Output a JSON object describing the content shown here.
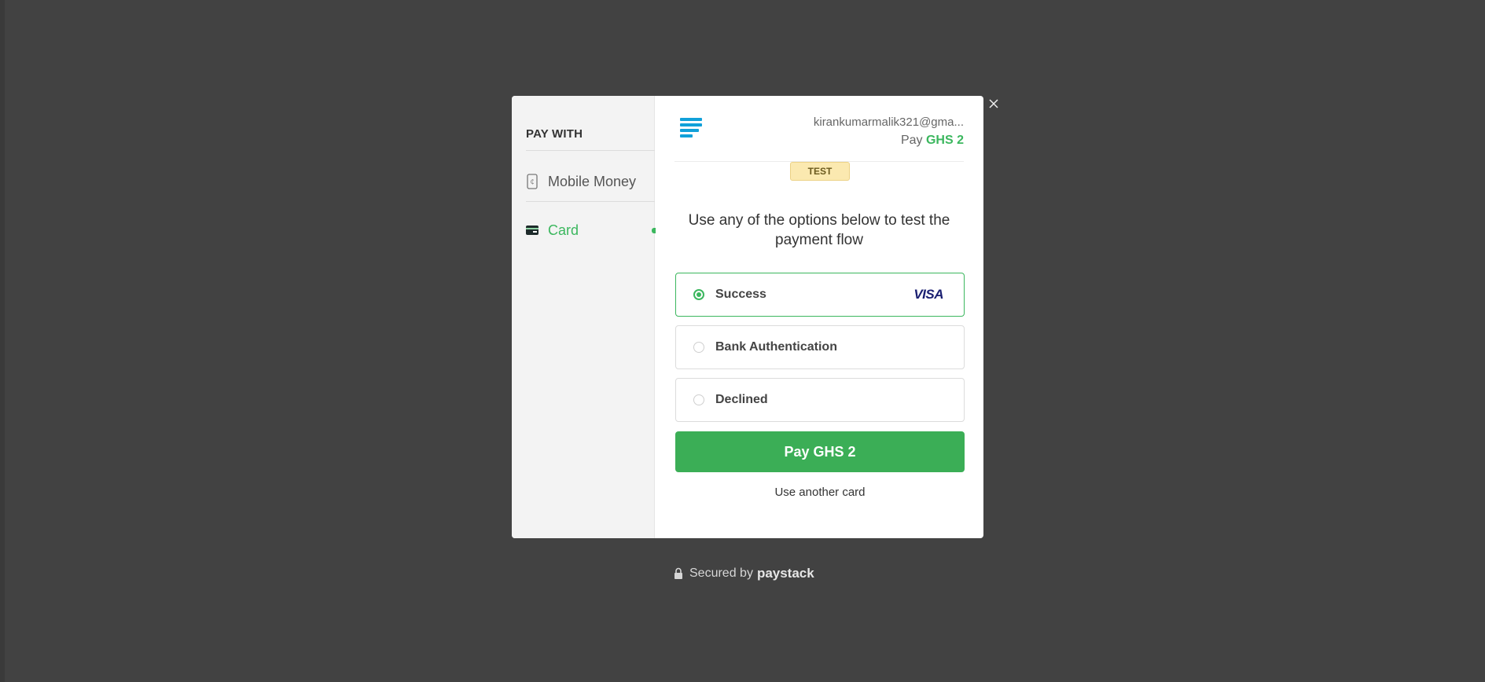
{
  "sidebar": {
    "title": "PAY WITH",
    "items": [
      {
        "label": "Mobile Money",
        "icon": "mobile-phone-icon",
        "active": false
      },
      {
        "label": "Card",
        "icon": "credit-card-icon",
        "active": true
      }
    ]
  },
  "header": {
    "logo": "stacked-bars-logo-icon",
    "email": "kirankumarmalik321@gma...",
    "pay_label": "Pay",
    "amount": "GHS 2"
  },
  "test_badge": "TEST",
  "instruction": "Use any of the options below to test the payment flow",
  "options": [
    {
      "label": "Success",
      "selected": true,
      "brand": "VISA"
    },
    {
      "label": "Bank Authentication",
      "selected": false
    },
    {
      "label": "Declined",
      "selected": false
    }
  ],
  "pay_button_label": "Pay GHS 2",
  "another_card_label": "Use another card",
  "footer": {
    "secured_text": "Secured by",
    "brand": "paystack"
  },
  "colors": {
    "accent": "#3bb75e",
    "button": "#3bae56",
    "logo": "#11a0d9",
    "overlay": "#424242",
    "badge_bg": "#fbe9b0"
  }
}
